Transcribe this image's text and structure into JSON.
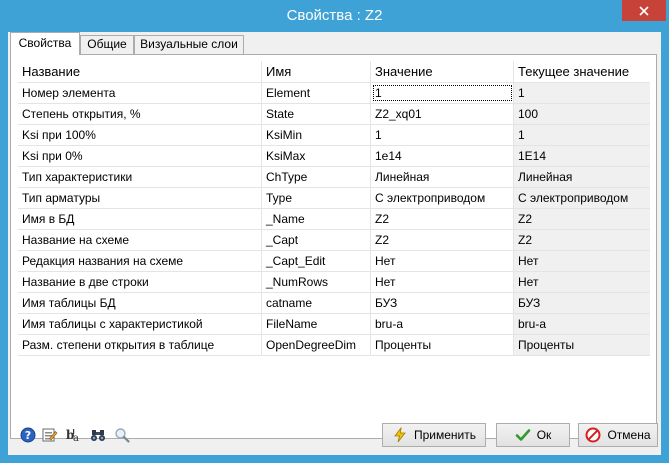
{
  "window": {
    "title": "Свойства :  Z2"
  },
  "tabs": [
    {
      "label": "Свойства"
    },
    {
      "label": "Общие"
    },
    {
      "label": "Визуальные слои"
    }
  ],
  "grid": {
    "columns": [
      "Название",
      "Имя",
      "Значение",
      "Текущее значение"
    ],
    "rows": [
      [
        "Номер элемента",
        "Element",
        "1",
        "1"
      ],
      [
        "Степень открытия, %",
        "State",
        "Z2_xq01",
        "100"
      ],
      [
        "Ksi при 100%",
        "KsiMin",
        "1",
        "1"
      ],
      [
        "Ksi при 0%",
        "KsiMax",
        "1e14",
        "1E14"
      ],
      [
        "Тип характеристики",
        "ChType",
        "Линейная",
        "Линейная"
      ],
      [
        "Тип арматуры",
        "Type",
        "С электроприводом",
        "С электроприводом"
      ],
      [
        "Имя в БД",
        "_Name",
        "Z2",
        "Z2"
      ],
      [
        "Название на схеме",
        "_Capt",
        "Z2",
        "Z2"
      ],
      [
        "Редакция названия на схеме",
        "_Capt_Edit",
        "Нет",
        "Нет"
      ],
      [
        "Название в две строки",
        "_NumRows",
        "Нет",
        "Нет"
      ],
      [
        "Имя таблицы БД",
        "catname",
        "БУЗ",
        "БУЗ"
      ],
      [
        "Имя таблицы с характеристикой",
        "FileName",
        "bru-a",
        "bru-a"
      ],
      [
        "Разм. степени открытия в таблице",
        "OpenDegreeDim",
        "Проценты",
        "Проценты"
      ]
    ]
  },
  "buttons": {
    "apply": "Применить",
    "ok": "Ок",
    "cancel": "Отмена"
  },
  "icons": [
    "help-icon",
    "edit-properties-icon",
    "text-format-icon",
    "binoculars-icon",
    "magnifier-icon"
  ],
  "colors": {
    "titlebar": "#3FA2D6",
    "close": "#C7433A",
    "ok_check": "#2E9A2E",
    "cancel_red": "#D62020",
    "apply_yellow": "#F2C300"
  }
}
